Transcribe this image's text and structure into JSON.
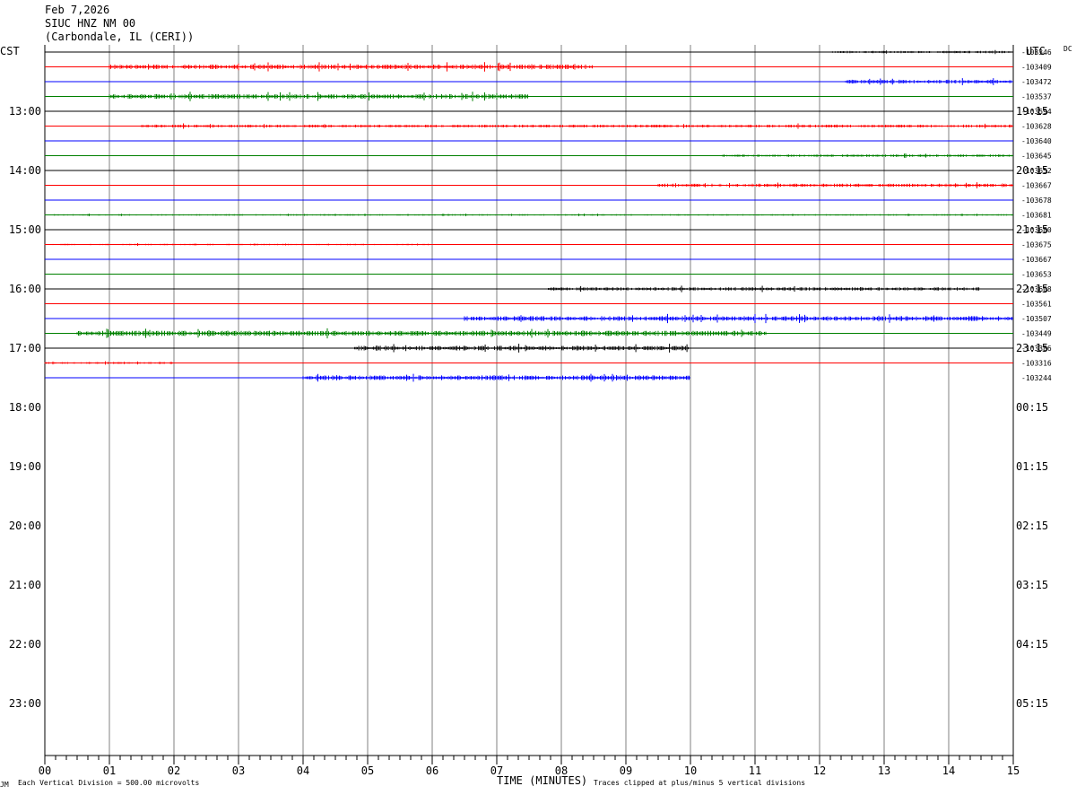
{
  "header": {
    "date": "Feb 7,2026",
    "station": "SIUC HNZ NM 00",
    "location": "(Carbondale, IL (CERI))"
  },
  "left_zone_label": "CST",
  "right_zone_label": "UTC",
  "dc_label": "DC",
  "footer": {
    "scale_text": "Each Vertical Division =  500.00 microvolts",
    "xlabel": "TIME (MINUTES)",
    "clip_text": "Traces clipped at plus/minus 5 vertical divisions",
    "corner_mark": "JM"
  },
  "chart_data": {
    "type": "line",
    "title": "",
    "xlabel": "TIME (MINUTES)",
    "ylabel": "",
    "xlim": [
      0,
      15
    ],
    "x_ticks": [
      "00",
      "01",
      "02",
      "03",
      "04",
      "05",
      "06",
      "07",
      "08",
      "09",
      "10",
      "11",
      "12",
      "13",
      "14",
      "15"
    ],
    "grid": true,
    "left_hour_labels": [
      "13:00",
      "14:00",
      "15:00",
      "16:00",
      "17:00",
      "18:00",
      "19:00",
      "20:00",
      "21:00",
      "22:00",
      "23:00"
    ],
    "right_hour_labels": [
      "19:15",
      "20:15",
      "21:15",
      "22:15",
      "23:15",
      "00:15",
      "01:15",
      "02:15",
      "03:15",
      "04:15",
      "05:15"
    ],
    "trace_colors": [
      "#000000",
      "#ff0000",
      "#0000ff",
      "#008000"
    ],
    "traces": [
      {
        "dc": "-103346",
        "color": "#000000",
        "noise": [
          12.2,
          15.0,
          1.0
        ]
      },
      {
        "dc": "-103409",
        "color": "#ff0000",
        "noise": [
          1.0,
          8.5,
          2.0
        ]
      },
      {
        "dc": "-103472",
        "color": "#0000ff",
        "noise": [
          12.4,
          15.0,
          1.6
        ]
      },
      {
        "dc": "-103537",
        "color": "#008000",
        "noise": [
          1.0,
          7.5,
          2.0
        ]
      },
      {
        "dc": "-103594",
        "color": "#000000",
        "noise": [
          0,
          0,
          0
        ]
      },
      {
        "dc": "-103628",
        "color": "#ff0000",
        "noise": [
          1.5,
          15.0,
          1.2
        ]
      },
      {
        "dc": "-103640",
        "color": "#0000ff",
        "noise": [
          0,
          0,
          0
        ]
      },
      {
        "dc": "-103645",
        "color": "#008000",
        "noise": [
          10.5,
          15.0,
          1.0
        ]
      },
      {
        "dc": "-103652",
        "color": "#000000",
        "noise": [
          0,
          0,
          0
        ]
      },
      {
        "dc": "-103667",
        "color": "#ff0000",
        "noise": [
          9.5,
          15.0,
          1.4
        ]
      },
      {
        "dc": "-103678",
        "color": "#0000ff",
        "noise": [
          0,
          0,
          0
        ]
      },
      {
        "dc": "-103681",
        "color": "#008000",
        "noise": [
          0,
          15.0,
          0.6
        ]
      },
      {
        "dc": "-103680",
        "color": "#000000",
        "noise": [
          0,
          0,
          0
        ]
      },
      {
        "dc": "-103675",
        "color": "#ff0000",
        "noise": [
          0,
          6.0,
          0.6
        ]
      },
      {
        "dc": "-103667",
        "color": "#0000ff",
        "noise": [
          0,
          0,
          0
        ]
      },
      {
        "dc": "-103653",
        "color": "#008000",
        "noise": [
          0,
          0,
          0
        ]
      },
      {
        "dc": "-103608",
        "color": "#000000",
        "noise": [
          7.8,
          14.5,
          1.4
        ]
      },
      {
        "dc": "-103561",
        "color": "#ff0000",
        "noise": [
          0,
          0,
          0
        ]
      },
      {
        "dc": "-103507",
        "color": "#0000ff",
        "noise": [
          6.5,
          15.0,
          2.0
        ]
      },
      {
        "dc": "-103449",
        "color": "#008000",
        "noise": [
          0.5,
          11.2,
          2.2
        ]
      },
      {
        "dc": "-103386",
        "color": "#000000",
        "noise": [
          4.8,
          10.0,
          2.0
        ]
      },
      {
        "dc": "-103316",
        "color": "#ff0000",
        "noise": [
          0,
          2.0,
          0.8
        ]
      },
      {
        "dc": "-103244",
        "color": "#0000ff",
        "noise": [
          4.0,
          10.0,
          2.0
        ],
        "end_minute": 10
      }
    ]
  }
}
